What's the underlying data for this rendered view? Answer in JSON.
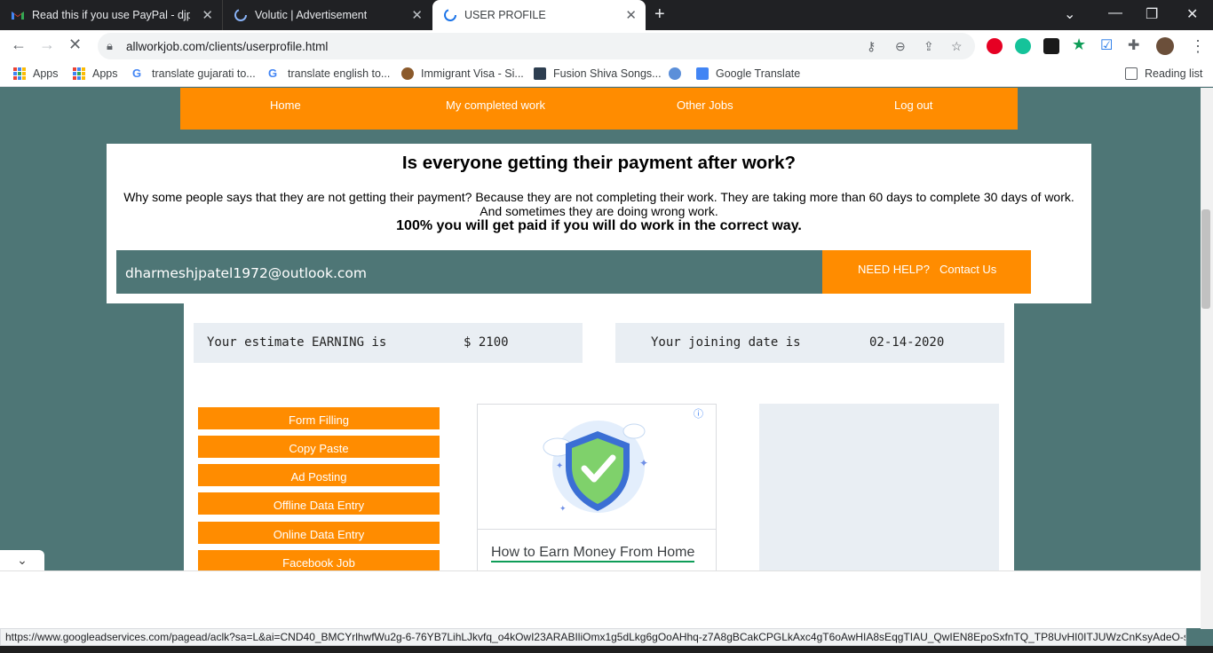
{
  "browser": {
    "tabs": [
      {
        "title": "Read this if you use PayPal - djpa",
        "favicon": "gmail-icon"
      },
      {
        "title": "Volutic | Advertisement",
        "favicon": "loading-spinner-icon"
      },
      {
        "title": "USER PROFILE",
        "favicon": "loading-spinner-icon",
        "active": true
      }
    ],
    "url": "allworkjob.com/clients/userprofile.html",
    "bookmarks": [
      {
        "label": "Apps"
      },
      {
        "label": "Apps"
      },
      {
        "label": "translate gujarati to..."
      },
      {
        "label": "translate english to..."
      },
      {
        "label": "Immigrant Visa - Si..."
      },
      {
        "label": "Fusion Shiva Songs..."
      },
      {
        "label": ""
      },
      {
        "label": "Google Translate"
      }
    ],
    "reading_list": "Reading list",
    "status_url": "https://www.googleadservices.com/pagead/aclk?sa=L&ai=CND40_BMCYrlhwfWu2g-6-76YB7LihLJkvfq_o4kOwI23ARABIliOmx1g5dLkg6gOoAHhq-z7A8gBCakCPGLkAxc4gT6oAwHIA8sEqgTIAU_QwIEN8EpoSxfnTQ_TP8UvHI0ITJUWzCnKsyAdeO-sJ4C5c..."
  },
  "nav": {
    "home": "Home",
    "completed": "My completed work",
    "other": "Other Jobs",
    "logout": "Log out"
  },
  "notice": {
    "title": "Is everyone getting their payment after work?",
    "line1": "Why some people says that they are not getting their payment? Because they are not completing their work. They are taking more than 60 days to complete 30 days of work.",
    "line2": "And sometimes they are doing wrong work.",
    "strong": "100% you will get paid if you will do work in the correct way."
  },
  "account": {
    "email": "dharmeshjpatel1972@outlook.com",
    "help": "NEED HELP?",
    "contact": "Contact Us"
  },
  "stats": {
    "earning_label": "Your estimate EARNING is",
    "earning_value": "$ 2100",
    "joining_label": "Your joining date is",
    "joining_value": "02-14-2020"
  },
  "services": [
    "Form Filling",
    "Copy Paste",
    "Ad Posting",
    "Offline Data Entry",
    "Online Data Entry",
    "Facebook Job"
  ],
  "ad": {
    "link": "How to Earn Money From Home",
    "info_icon": "info-icon"
  },
  "colors": {
    "accent": "#ff8c00",
    "background": "#4e7676",
    "panel": "#e9eef3"
  }
}
